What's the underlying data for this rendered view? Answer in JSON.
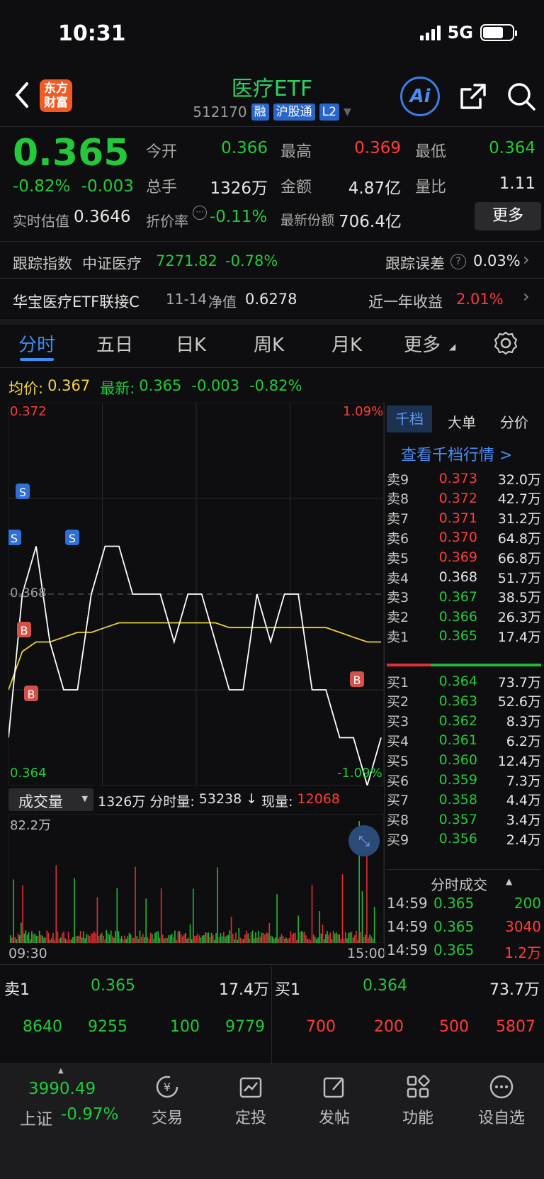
{
  "status": {
    "time": "10:31",
    "network": "5G"
  },
  "header": {
    "logo_line1": "东方",
    "logo_line2": "财富",
    "title": "医疗ETF",
    "code": "512170",
    "tags": [
      "融",
      "沪股通",
      "L2"
    ],
    "ai_label": "Ai"
  },
  "quote": {
    "price": "0.365",
    "change_pct": "-0.82%",
    "change_abs": "-0.003",
    "fields": [
      {
        "label": "今开",
        "value": "0.366",
        "color": "green"
      },
      {
        "label": "最高",
        "value": "0.369",
        "color": "red"
      },
      {
        "label": "最低",
        "value": "0.364",
        "color": "green"
      },
      {
        "label": "总手",
        "value": "1326万",
        "color": "white"
      },
      {
        "label": "金额",
        "value": "4.87亿",
        "color": "white"
      },
      {
        "label": "量比",
        "value": "1.11",
        "color": "white"
      }
    ],
    "realtime_label": "实时估值",
    "realtime_value": "0.3646",
    "discount_label": "折价率",
    "discount_value": "-0.11%",
    "shares_label": "最新份额",
    "shares_value": "706.4亿",
    "more_label": "更多"
  },
  "tracking": {
    "label": "跟踪指数",
    "index_name": "中证医疗",
    "index_value": "7271.82",
    "index_change": "-0.78%",
    "error_label": "跟踪误差",
    "error_value": "0.03%"
  },
  "linked_fund": {
    "name": "华宝医疗ETF联接C",
    "date": "11-14",
    "nav_label": "净值",
    "nav_value": "0.6278",
    "yield_label": "近一年收益",
    "yield_value": "2.01%"
  },
  "tabs": [
    "分时",
    "五日",
    "日K",
    "周K",
    "月K",
    "更多"
  ],
  "chart_header": {
    "avg_label": "均价:",
    "avg_value": "0.367",
    "latest_label": "最新:",
    "latest_value": "0.365",
    "latest_change": "-0.003",
    "latest_pct": "-0.82%"
  },
  "chart_data": {
    "type": "line",
    "y_top": "0.372",
    "y_bottom": "0.364",
    "y_mid": "0.368",
    "pct_top": "1.09%",
    "pct_bottom": "-1.09%",
    "time_start": "09:30",
    "time_end": "15:00",
    "ylim": [
      0.364,
      0.372
    ],
    "series": [
      {
        "name": "价格",
        "values": [
          0.365,
          0.368,
          0.369,
          0.367,
          0.366,
          0.366,
          0.368,
          0.369,
          0.369,
          0.368,
          0.368,
          0.368,
          0.367,
          0.368,
          0.368,
          0.367,
          0.366,
          0.366,
          0.368,
          0.367,
          0.368,
          0.368,
          0.366,
          0.366,
          0.365,
          0.365,
          0.364,
          0.365
        ]
      },
      {
        "name": "均价",
        "values": [
          0.366,
          0.3668,
          0.367,
          0.367,
          0.3671,
          0.3672,
          0.3672,
          0.3673,
          0.3674,
          0.3674,
          0.3674,
          0.3674,
          0.3674,
          0.3674,
          0.3674,
          0.3674,
          0.3673,
          0.3673,
          0.3673,
          0.3673,
          0.3673,
          0.3673,
          0.3673,
          0.3673,
          0.3672,
          0.3671,
          0.367,
          0.367
        ]
      }
    ],
    "volume_max_label": "82.2万"
  },
  "volume_header": {
    "label": "成交量",
    "total": "1326万",
    "minute_label": "分时量:",
    "minute_value": "53238",
    "current_label": "现量:",
    "current_value": "12068"
  },
  "order_book_tabs": [
    "千档",
    "大单",
    "分价"
  ],
  "order_book_link": "查看千档行情 >",
  "asks": [
    {
      "label": "卖9",
      "price": "0.373",
      "vol": "32.0万",
      "color": "red"
    },
    {
      "label": "卖8",
      "price": "0.372",
      "vol": "42.7万",
      "color": "red"
    },
    {
      "label": "卖7",
      "price": "0.371",
      "vol": "31.2万",
      "color": "red"
    },
    {
      "label": "卖6",
      "price": "0.370",
      "vol": "64.8万",
      "color": "red"
    },
    {
      "label": "卖5",
      "price": "0.369",
      "vol": "66.8万",
      "color": "red"
    },
    {
      "label": "卖4",
      "price": "0.368",
      "vol": "51.7万",
      "color": "white"
    },
    {
      "label": "卖3",
      "price": "0.367",
      "vol": "38.5万",
      "color": "green"
    },
    {
      "label": "卖2",
      "price": "0.366",
      "vol": "26.3万",
      "color": "green"
    },
    {
      "label": "卖1",
      "price": "0.365",
      "vol": "17.4万",
      "color": "green"
    }
  ],
  "bids": [
    {
      "label": "买1",
      "price": "0.364",
      "vol": "73.7万",
      "color": "green"
    },
    {
      "label": "买2",
      "price": "0.363",
      "vol": "52.6万",
      "color": "green"
    },
    {
      "label": "买3",
      "price": "0.362",
      "vol": "8.3万",
      "color": "green"
    },
    {
      "label": "买4",
      "price": "0.361",
      "vol": "6.2万",
      "color": "green"
    },
    {
      "label": "买5",
      "price": "0.360",
      "vol": "12.4万",
      "color": "green"
    },
    {
      "label": "买6",
      "price": "0.359",
      "vol": "7.3万",
      "color": "green"
    },
    {
      "label": "买7",
      "price": "0.358",
      "vol": "4.4万",
      "color": "green"
    },
    {
      "label": "买8",
      "price": "0.357",
      "vol": "3.4万",
      "color": "green"
    },
    {
      "label": "买9",
      "price": "0.356",
      "vol": "2.4万",
      "color": "green"
    }
  ],
  "trades_title": "分时成交",
  "trades": [
    {
      "time": "14:59",
      "price": "0.365",
      "vol": "200",
      "color": "green"
    },
    {
      "time": "14:59",
      "price": "0.365",
      "vol": "3040",
      "color": "red"
    },
    {
      "time": "14:59",
      "price": "0.365",
      "vol": "1.2万",
      "color": "red"
    }
  ],
  "level1": {
    "ask_label": "卖1",
    "ask_price": "0.365",
    "ask_vol": "17.4万",
    "bid_label": "买1",
    "bid_price": "0.364",
    "bid_vol": "73.7万",
    "ask_queue": [
      "8640",
      "9255",
      "100",
      "9779"
    ],
    "bid_queue": [
      "700",
      "200",
      "500",
      "5807"
    ]
  },
  "bottom_nav": {
    "index_value": "3990.49",
    "index_name": "上证",
    "index_change": "-0.97%",
    "items": [
      "交易",
      "定投",
      "发帖",
      "功能",
      "设自选"
    ]
  }
}
